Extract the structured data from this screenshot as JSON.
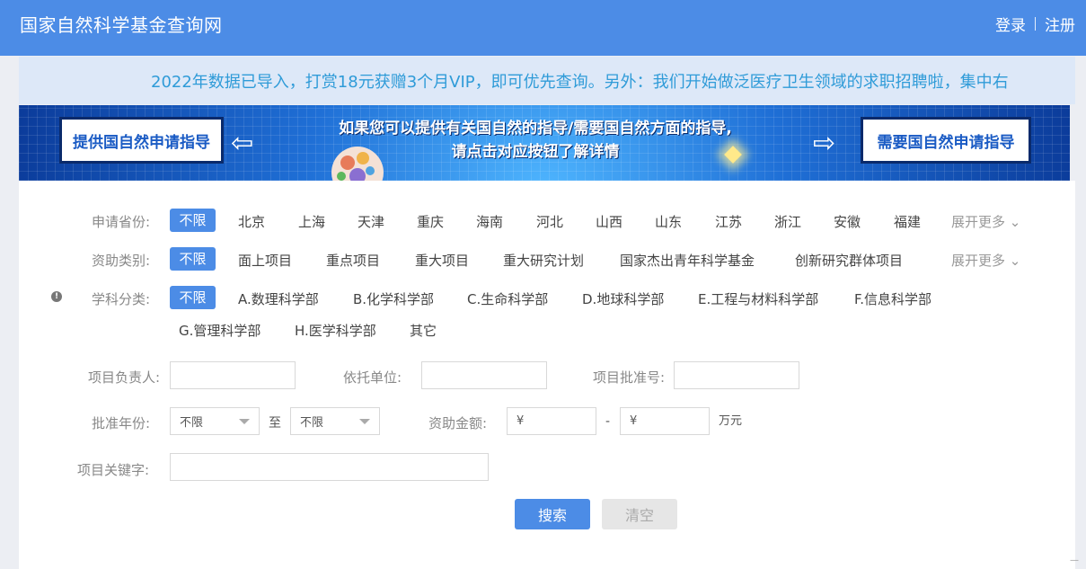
{
  "header": {
    "title": "国家自然科学基金查询网",
    "login": "登录",
    "register": "注册"
  },
  "notice": {
    "text": "2022年数据已导入，打赏18元获赠3个月VIP，即可优先查询。另外：我们开始做泛医疗卫生领域的求职招聘啦，集中右"
  },
  "banner": {
    "left_button": "提供国自然申请指导",
    "right_button": "需要国自然申请指导",
    "line1": "如果您可以提供有关国自然的指导/需要国自然方面的指导,",
    "line2": "请点击对应按钮了解详情",
    "arrow_left": "⇦",
    "arrow_right": "⇨"
  },
  "filters": {
    "province": {
      "label": "申请省份:",
      "options": [
        "不限",
        "北京",
        "上海",
        "天津",
        "重庆",
        "海南",
        "河北",
        "山西",
        "山东",
        "江苏",
        "浙江",
        "安徽",
        "福建"
      ],
      "more": "展开更多"
    },
    "funding_type": {
      "label": "资助类别:",
      "options": [
        "不限",
        "面上项目",
        "重点项目",
        "重大项目",
        "重大研究计划",
        "国家杰出青年科学基金",
        "创新研究群体项目"
      ],
      "more": "展开更多"
    },
    "discipline": {
      "label": "学科分类:",
      "options": [
        "不限",
        "A.数理科学部",
        "B.化学科学部",
        "C.生命科学部",
        "D.地球科学部",
        "E.工程与材料科学部",
        "F.信息科学部",
        "G.管理科学部",
        "H.医学科学部",
        "其它"
      ]
    }
  },
  "form": {
    "leader_label": "项目负责人:",
    "leader_value": "",
    "unit_label": "依托单位:",
    "unit_value": "",
    "approval_no_label": "项目批准号:",
    "approval_no_value": "",
    "year_label": "批准年份:",
    "year_from": "不限",
    "year_to_label": "至",
    "year_to": "不限",
    "amount_label": "资助金额:",
    "amount_min": "¥",
    "amount_dash": "-",
    "amount_max": "¥",
    "amount_unit": "万元",
    "keyword_label": "项目关键字:",
    "keyword_value": ""
  },
  "buttons": {
    "search": "搜索",
    "clear": "清空"
  },
  "colors": {
    "primary": "#4c8ce6",
    "notice_text": "#2f9bd8",
    "notice_bg": "#dde8f8"
  }
}
